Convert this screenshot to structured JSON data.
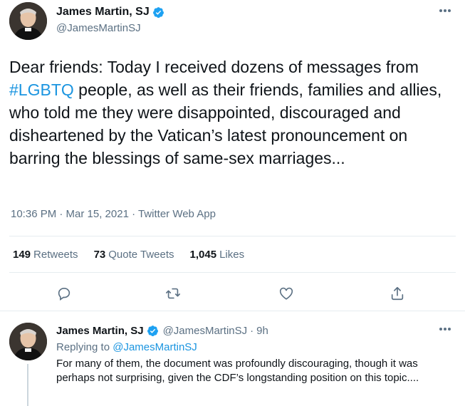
{
  "main_tweet": {
    "author": {
      "display_name": "James Martin, SJ",
      "handle": "@JamesMartinSJ",
      "verified": true
    },
    "text_before_hashtag": "Dear friends: Today I received dozens of messages from ",
    "hashtag": "#LGBTQ",
    "text_after_hashtag": " people, as well as their friends, families and allies, who told me they were disappointed, discouraged and disheartened by the Vatican’s latest pronouncement on barring the blessings of same-sex marriages...",
    "timestamp": "10:36 PM · Mar 15, 2021 · Twitter Web App",
    "stats": {
      "retweets_count": "149",
      "retweets_label": "Retweets",
      "quote_tweets_count": "73",
      "quote_tweets_label": "Quote Tweets",
      "likes_count": "1,045",
      "likes_label": "Likes"
    },
    "actions": [
      "reply-icon",
      "retweet-icon",
      "like-icon",
      "share-icon"
    ]
  },
  "reply_tweet": {
    "author": {
      "display_name": "James Martin, SJ",
      "handle": "@JamesMartinSJ",
      "verified": true
    },
    "separator": "·",
    "age": "9h",
    "replying_label": "Replying to",
    "replying_to": "@JamesMartinSJ",
    "text": "For many of them, the document was profoundly discouraging, though it was perhaps not surprising, given the CDF’s longstanding position on this topic...."
  },
  "colors": {
    "text": "#0f1419",
    "secondary": "#5b7083",
    "link": "#1b95e0",
    "verified": "#1da1f2",
    "border": "#e6ecf0"
  }
}
